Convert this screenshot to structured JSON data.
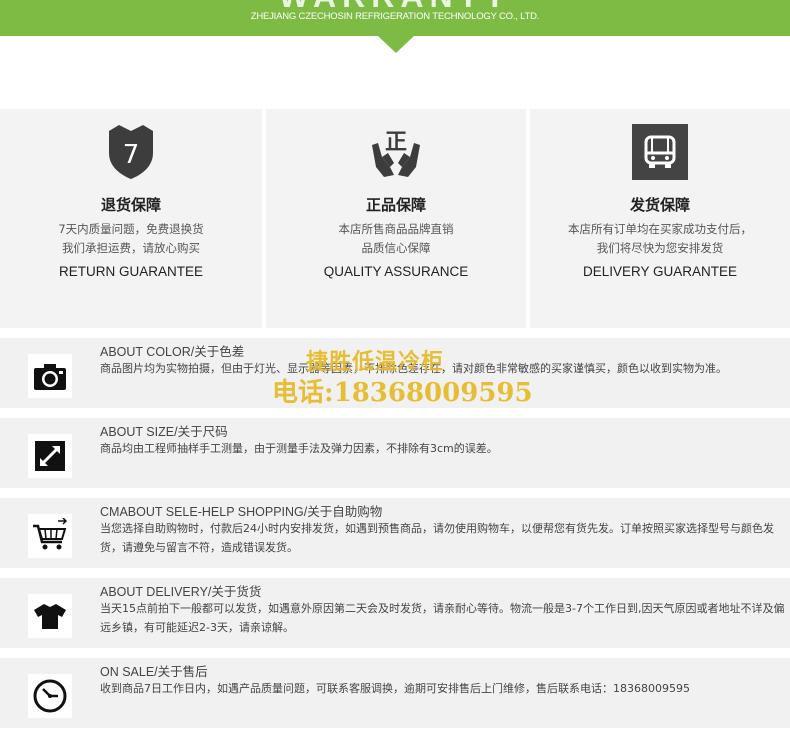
{
  "header": {
    "title": "WARRANTY",
    "company": "ZHEJIANG CZECHOSIN REFRIGERATION TECHNOLOGY CO., LTD.",
    "accent_color": "#7dbb45"
  },
  "guarantees": [
    {
      "icon": "seven-shield-icon",
      "title": "退货保障",
      "line1": "7天内质量问题，免费退换货",
      "line2": "我们承担运费，请放心购买",
      "english": "RETURN GUARANTEE"
    },
    {
      "icon": "genuine-hands-icon",
      "title": "正品保障",
      "line1": "本店所售商品品牌直销",
      "line2": "品质信心保障",
      "english": "QUALITY ASSURANCE"
    },
    {
      "icon": "truck-icon",
      "title": "发货保障",
      "line1": "本店所有订单均在买家成功支付后，",
      "line2": "我们将尽快为您安排发货",
      "english": "DELIVERY GUARANTEE"
    }
  ],
  "about": [
    {
      "icon": "camera-icon",
      "title": "ABOUT COLOR/关于色差",
      "body": "商品图片均为实物拍摄，但由于灯光、显示器等因素，不排除色差存在，请对颜色非常敏感的买家谨慎买，颜色以收到实物为准。"
    },
    {
      "icon": "ruler-size-icon",
      "title": "ABOUT SIZE/关于尺码",
      "body": "商品均由工程师抽样手工测量，由于测量手法及弹力因素，不排除有3cm的误差。"
    },
    {
      "icon": "shopping-cart-icon",
      "title": "CMABOUT SELE-HELP SHOPPING/关于自助购物",
      "body": "当您选择自助购物时，付款后24小时内安排发货，如遇到预售商品，请勿使用购物车，以便帮您有货先发。订单按照买家选择型号与颜色发货，请遵免与留言不符，造成错误发货。"
    },
    {
      "icon": "tshirt-icon",
      "title": "ABOUT DELIVERY/关于货货",
      "body": "当天15点前拍下一般都可以发货，如遇意外原因第二天会及时发货，请亲耐心等待。物流一般是3-7个工作日到,因天气原因或者地址不详及偏远乡镇，有可能延迟2-3天，请亲谅解。"
    },
    {
      "icon": "clock-icon",
      "title": "ON SALE/关于售后",
      "body": "收到商品7日工作日内，如遇产品质量问题，可联系客服调换，逾期可安排售后上门维修，售后联系电话：18368009595"
    }
  ],
  "watermark": {
    "line1": "捷胜低温冷柜",
    "line2": "电话:18368009595",
    "color": "#e2b00a"
  }
}
